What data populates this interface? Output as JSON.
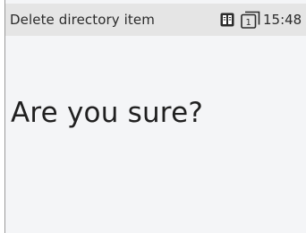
{
  "status_bar": {
    "title": "Delete directory item",
    "time": "15:48",
    "icons": [
      "book-icon",
      "sim-card-icon"
    ],
    "sim_slot": "1"
  },
  "dialog": {
    "message": "Are you sure?"
  },
  "colors": {
    "status_bar_bg": "#e5e5e5",
    "screen_bg": "#f4f5f7",
    "text": "#202020"
  }
}
